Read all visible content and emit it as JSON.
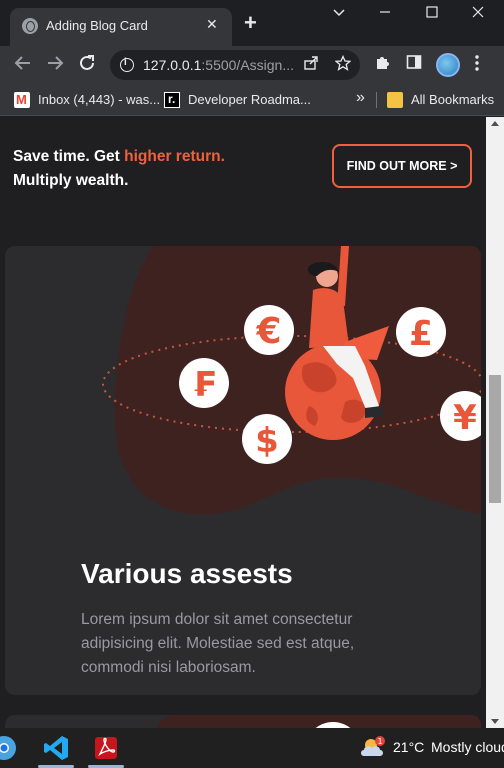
{
  "browser": {
    "tab_title": "Adding Blog Card",
    "tab_close": "✕",
    "new_tab": "+",
    "url_host": "127.0.0.1",
    "url_rest": ":5500/Assign...",
    "bookmarks": [
      {
        "label": "Inbox (4,443) - was..."
      },
      {
        "label": "Developer Roadma..."
      }
    ],
    "bookmarks_overflow": "»",
    "all_bookmarks": "All Bookmarks"
  },
  "promo": {
    "line1_prefix": "Save time. Get ",
    "line1_highlight": "higher return.",
    "line2": "Multiply wealth.",
    "button_label": "FIND OUT MORE >"
  },
  "card": {
    "title": "Various assests",
    "body": "Lorem ipsum dolor sit amet consectetur adipisicing elit. Molestiae sed est atque, commodi nisi laboriosam.",
    "currency_symbols": [
      "€",
      "£",
      "₣",
      "$",
      "¥"
    ]
  },
  "taskbar": {
    "weather_temp": "21°C",
    "weather_desc": "Mostly cloudy",
    "weather_badge": "1"
  },
  "colors": {
    "accent": "#f0603c",
    "card_bg": "#2c2c2f",
    "page_bg": "#1f1f22",
    "blob": "#3e2220"
  }
}
